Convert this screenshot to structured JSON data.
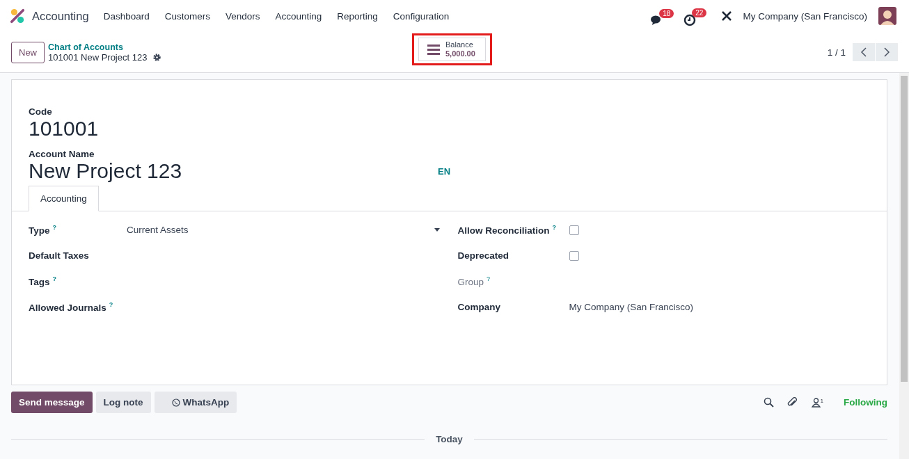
{
  "navbar": {
    "app_name": "Accounting",
    "menu": [
      "Dashboard",
      "Customers",
      "Vendors",
      "Accounting",
      "Reporting",
      "Configuration"
    ],
    "messages_count": "18",
    "activities_count": "22",
    "company": "My Company (San Francisco)"
  },
  "control_panel": {
    "new_button": "New",
    "breadcrumb": "Chart of Accounts",
    "record_title": "101001 New Project 123",
    "smart_button": {
      "label": "Balance",
      "value": "5,000.00",
      "highlighted": true
    },
    "pager": "1 / 1"
  },
  "form": {
    "code_label": "Code",
    "code": "101001",
    "name_label": "Account Name",
    "name": "New Project 123",
    "language": "EN",
    "tabs": [
      {
        "label": "Accounting",
        "selected": true
      }
    ],
    "left_fields": [
      {
        "label": "Type",
        "help": "?",
        "value": "Current Assets",
        "kind": "select"
      },
      {
        "label": "Default Taxes",
        "kind": "empty"
      },
      {
        "label": "Tags",
        "help": "?",
        "kind": "empty"
      },
      {
        "label": "Allowed Journals",
        "help": "?",
        "kind": "empty"
      }
    ],
    "right_fields": [
      {
        "label": "Allow Reconciliation",
        "help": "?",
        "kind": "checkbox",
        "checked": false,
        "muted": false
      },
      {
        "label": "Deprecated",
        "kind": "checkbox",
        "checked": false,
        "muted": false
      },
      {
        "label": "Group",
        "help": "?",
        "kind": "empty",
        "muted": true
      },
      {
        "label": "Company",
        "value": "My Company (San Francisco)",
        "kind": "text",
        "muted": false
      }
    ]
  },
  "chatter": {
    "buttons": [
      "Send message",
      "Log note",
      "WhatsApp"
    ],
    "followers_count": "1",
    "follow_status": "Following",
    "date_separator": "Today"
  }
}
